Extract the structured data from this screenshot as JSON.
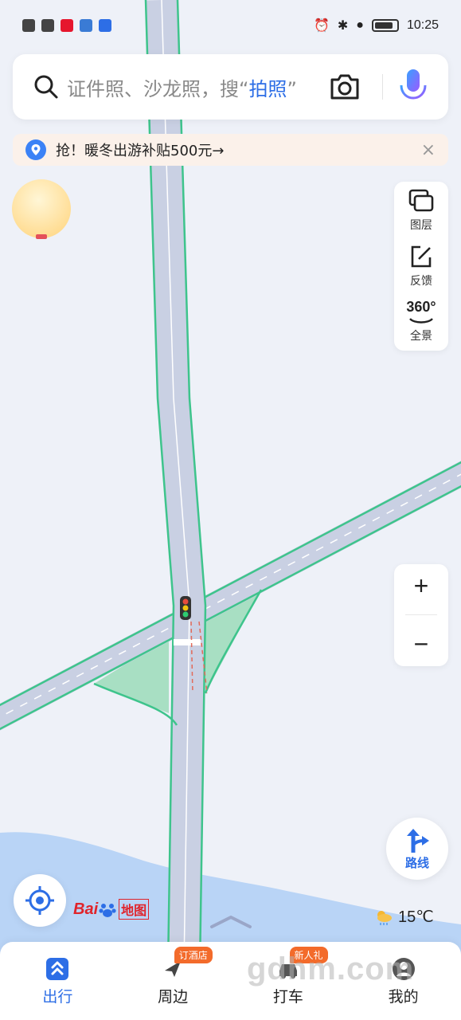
{
  "status_bar": {
    "time": "10:25"
  },
  "search": {
    "placeholder_prefix": "证件照、沙龙照，搜“",
    "highlight": "拍照",
    "placeholder_suffix": "”"
  },
  "promo": {
    "text": "抢！暖冬出游补贴500元→",
    "close": "×"
  },
  "tools": [
    {
      "label": "图层",
      "icon": "layers-icon"
    },
    {
      "label": "反馈",
      "icon": "feedback-icon"
    },
    {
      "label": "全景",
      "icon": "panorama-360-icon",
      "icon_text": "360°"
    }
  ],
  "zoom": {
    "in": "+",
    "out": "−"
  },
  "route": {
    "label": "路线"
  },
  "logo": {
    "bai": "Bai",
    "map": "地图"
  },
  "weather": {
    "temp": "15℃"
  },
  "nav": [
    {
      "label": "出行",
      "active": true,
      "icon": "travel-icon"
    },
    {
      "label": "周边",
      "badge": "订酒店",
      "icon": "nearby-icon"
    },
    {
      "label": "打车",
      "badge": "新人礼",
      "icon": "taxi-icon"
    },
    {
      "label": "我的",
      "icon": "profile-icon"
    }
  ],
  "watermark": "gdhm.com",
  "colors": {
    "accent": "#2d6ee6",
    "road": "#c9d0e3",
    "road_edge": "#3ec48c",
    "water": "#b9d4f6",
    "green_area": "#a8dfc3"
  }
}
